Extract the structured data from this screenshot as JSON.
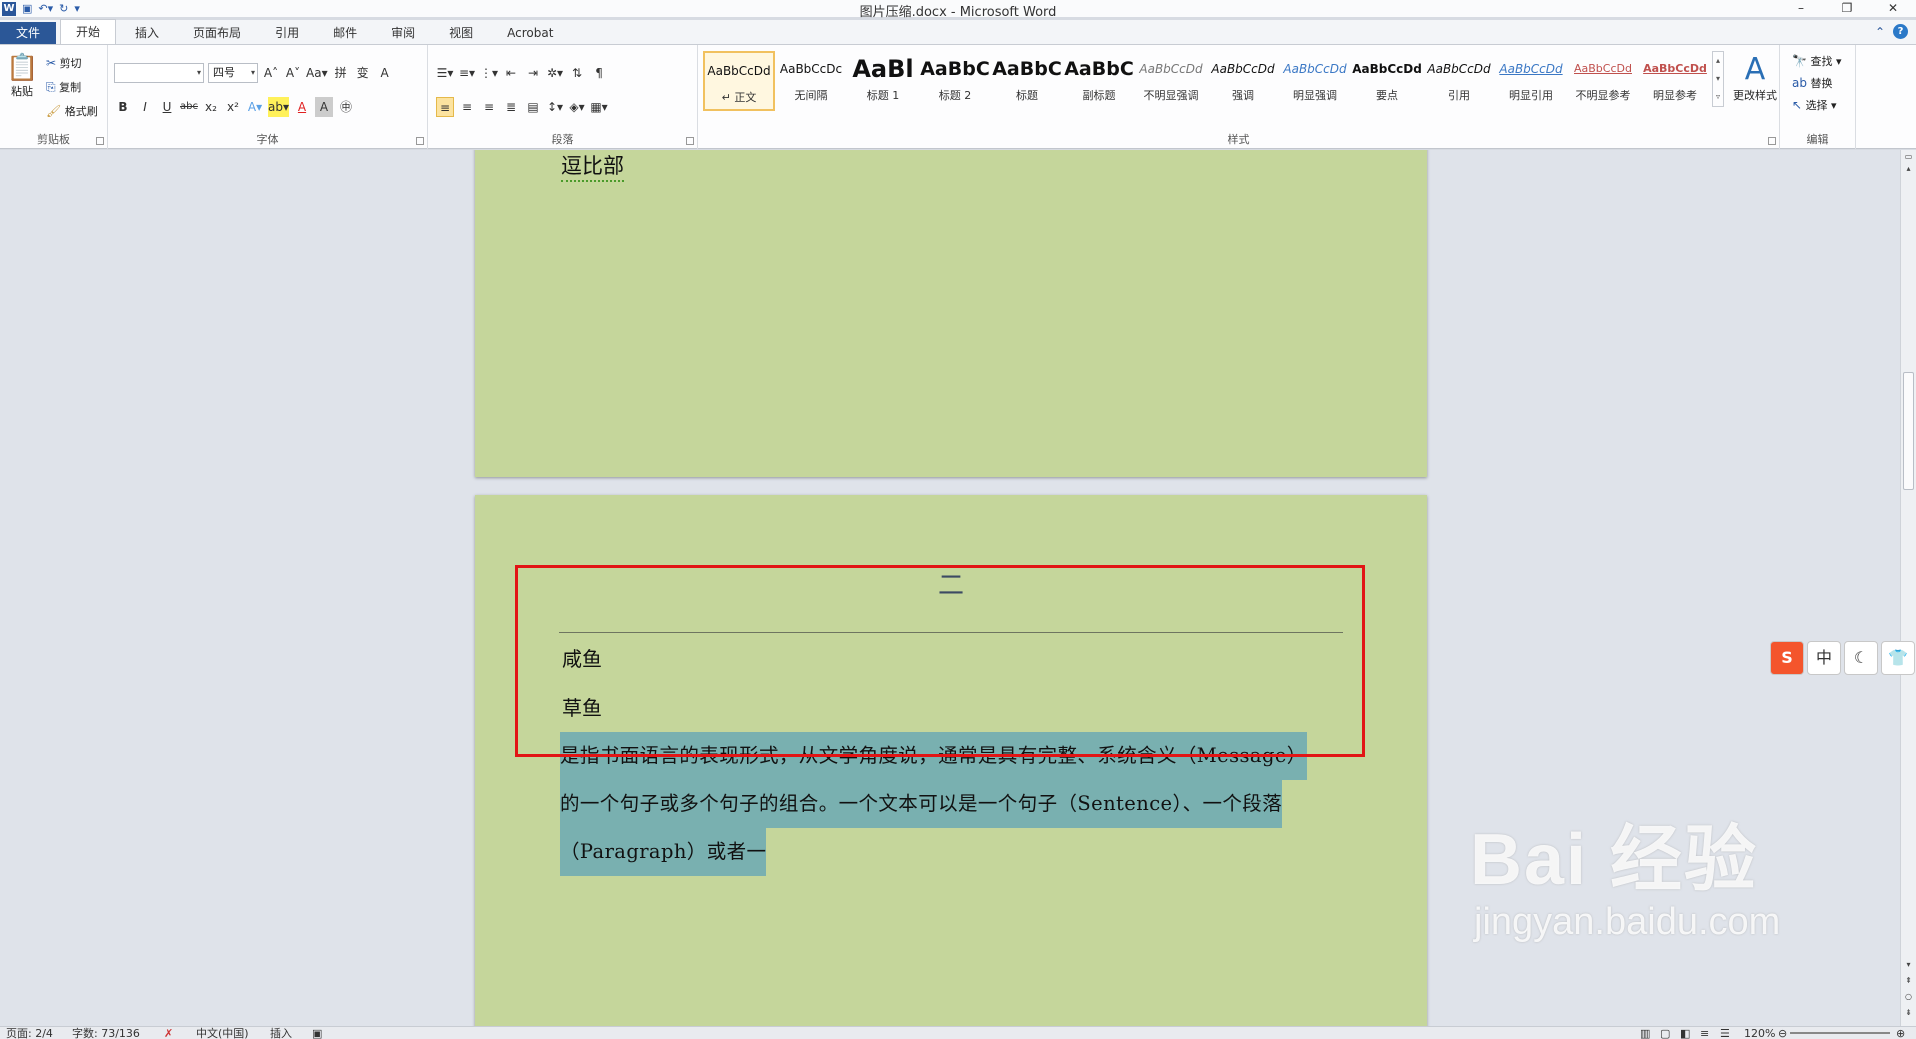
{
  "window": {
    "title": "图片压缩.docx - Microsoft Word",
    "minimize": "–",
    "restore": "❐",
    "close": "✕"
  },
  "qat": {
    "app_icon": "W",
    "save_icon": "floppy-icon",
    "undo_icon": "undo-icon",
    "redo_icon": "redo-icon"
  },
  "tabs": [
    "文件",
    "开始",
    "插入",
    "页面布局",
    "引用",
    "邮件",
    "审阅",
    "视图",
    "Acrobat"
  ],
  "ribbon": {
    "clipboard": {
      "label": "剪贴板",
      "paste": "粘贴",
      "cut": "剪切",
      "copy": "复制",
      "format_painter": "格式刷"
    },
    "font": {
      "label": "字体",
      "font_name": "",
      "font_size": "四号",
      "change_case": "Aa▾",
      "bold": "B",
      "italic": "I",
      "underline": "U",
      "strikethrough": "abc",
      "subscript": "x₂",
      "superscript": "x²",
      "grow": "A˄",
      "shrink": "A˅",
      "font_color_glyph": "A"
    },
    "paragraph": {
      "label": "段落"
    },
    "styles": {
      "label": "样式",
      "items": [
        {
          "sample": "AaBbCcDd",
          "name": "↵ 正文"
        },
        {
          "sample": "AaBbCcDc",
          "name": "无间隔"
        },
        {
          "sample": "AaBl",
          "name": "标题 1"
        },
        {
          "sample": "AaBbC",
          "name": "标题 2"
        },
        {
          "sample": "AaBbC",
          "name": "标题"
        },
        {
          "sample": "AaBbC",
          "name": "副标题"
        },
        {
          "sample": "AaBbCcDd",
          "name": "不明显强调"
        },
        {
          "sample": "AaBbCcDd",
          "name": "强调"
        },
        {
          "sample": "AaBbCcDd",
          "name": "明显强调"
        },
        {
          "sample": "AaBbCcDd",
          "name": "要点"
        },
        {
          "sample": "AaBbCcDd",
          "name": "引用"
        },
        {
          "sample": "AaBbCcDd",
          "name": "明显引用"
        },
        {
          "sample": "AaBbCcDd",
          "name": "不明显参考"
        },
        {
          "sample": "AaBbCcDd",
          "name": "明显参考"
        }
      ],
      "change_styles": "更改样式"
    },
    "editing": {
      "label": "编辑",
      "find": "查找 ▾",
      "replace": "替换",
      "select": "选择 ▾"
    }
  },
  "document": {
    "page1_text": "逗比部",
    "page2_header": "二",
    "lines": [
      "咸鱼",
      "草鱼"
    ],
    "selected_lines": [
      "是指书面语言的表现形式，从文学角度说，通常是具有完整、系统含义（Message）",
      "的一个句子或多个句子的组合。一个文本可以是一个句子（Sentence）、一个段落",
      "（Paragraph）或者一"
    ]
  },
  "ime": {
    "s": "S",
    "zh": "中",
    "moon": "☾",
    "shirt": "👕"
  },
  "watermark": {
    "brand": "Bai 经验",
    "url": "jingyan.baidu.com"
  },
  "status": {
    "page": "页面: 2/4",
    "words": "字数: 73/136",
    "language": "中文(中国)",
    "mode": "插入",
    "zoom": "120%"
  },
  "colors": {
    "page_background": "#c5d69b",
    "selection": "#79b0b0",
    "highlight_box": "#e21515",
    "file_tab": "#2b5797"
  }
}
